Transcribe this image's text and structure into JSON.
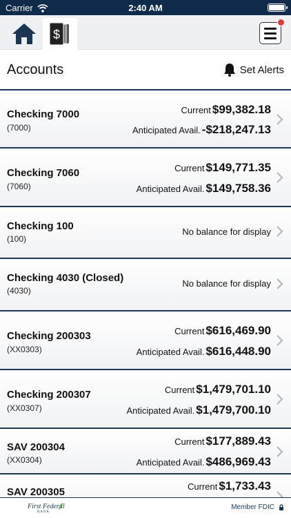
{
  "status_bar": {
    "carrier": "Carrier",
    "time": "2:40 AM"
  },
  "toolbar": {
    "tabs": [
      "home-icon",
      "accounts-icon"
    ],
    "menu_icon": "hamburger-menu-icon",
    "notification": true
  },
  "header": {
    "title": "Accounts",
    "alerts_label": "Set Alerts"
  },
  "accounts": [
    {
      "name": "Checking 7000",
      "number": "(7000)",
      "current_label": "Current",
      "current": "$99,382.18",
      "anticipated_label": "Anticipated Avail.",
      "anticipated": "-$218,247.13"
    },
    {
      "name": "Checking 7060",
      "number": "(7060)",
      "current_label": "Current",
      "current": "$149,771.35",
      "anticipated_label": "Anticipated Avail.",
      "anticipated": "$149,758.36"
    },
    {
      "name": "Checking 100",
      "number": "(100)",
      "no_balance": "No balance for display"
    },
    {
      "name": "Checking 4030 (Closed)",
      "number": "(4030)",
      "no_balance": "No balance for display"
    },
    {
      "name": "Checking 200303",
      "number": "(XX0303)",
      "current_label": "Current",
      "current": "$616,469.90",
      "anticipated_label": "Anticipated Avail.",
      "anticipated": "$616,448.90"
    },
    {
      "name": "Checking 200307",
      "number": "(XX0307)",
      "current_label": "Current",
      "current": "$1,479,701.10",
      "anticipated_label": "Anticipated Avail.",
      "anticipated": "$1,479,700.10"
    },
    {
      "name": "SAV 200304",
      "number": "(XX0304)",
      "current_label": "Current",
      "current": "$177,889.43",
      "anticipated_label": "Anticipated Avail.",
      "anticipated": "$486,969.43"
    },
    {
      "name": "SAV 200305",
      "number": "",
      "current_label": "Current",
      "current": "$1,733.43"
    }
  ],
  "footer": {
    "logo_text": "First Federal",
    "logo_sub": "BANK",
    "fdic": "Member FDIC"
  },
  "colors": {
    "navy": "#0f2a4a",
    "divider": "#1b3554",
    "alert_dot": "#e53935"
  }
}
